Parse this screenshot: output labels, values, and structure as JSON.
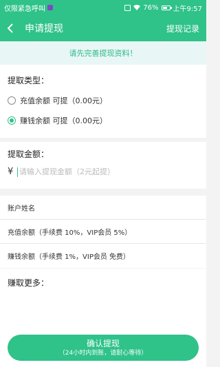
{
  "status_bar": {
    "carrier": "仅限紧急呼叫",
    "battery": "76%",
    "battery_level": 0.76,
    "time": "上午9:57"
  },
  "header": {
    "title": "申请提现",
    "history_label": "提现记录"
  },
  "notice": "请先完善提现资料！",
  "withdraw_type": {
    "title": "提取类型：",
    "options": [
      {
        "label": "充值余额  可提（0.00元）",
        "selected": false
      },
      {
        "label": "赚钱余额  可提（0.00元）",
        "selected": true
      }
    ]
  },
  "amount": {
    "title": "提取金额：",
    "currency": "¥",
    "placeholder": "请输入提现金额（2元起提）"
  },
  "info": {
    "items": [
      "账户姓名",
      "充值余额（手续费 10%，VIP会员 5%）",
      "赚钱余额（手续费 1%，VIP会员 免费）"
    ]
  },
  "more": {
    "title": "赚取更多："
  },
  "confirm": {
    "label": "确认提现",
    "sub": "（24小时内到账，请耐心等待）"
  },
  "colors": {
    "accent": "#2fc289",
    "notice_bg": "#e8f7f5",
    "notice_text": "#2fb889"
  }
}
